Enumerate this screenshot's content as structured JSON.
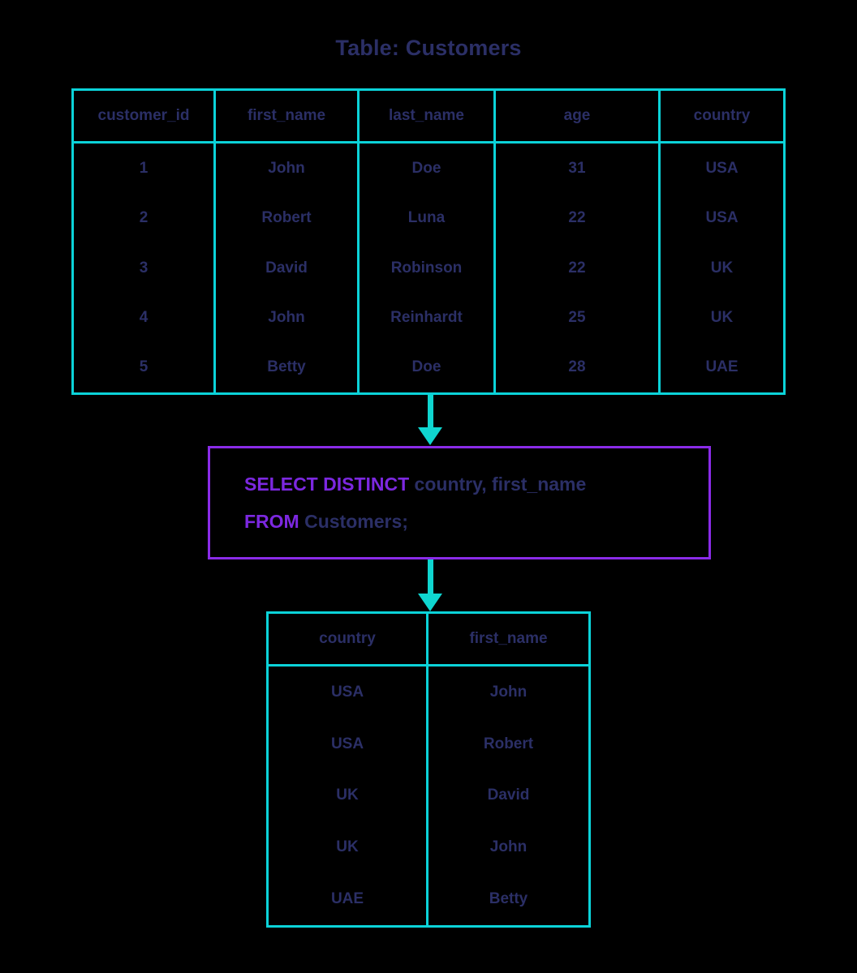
{
  "title": "Table: Customers",
  "colors": {
    "table_border": "#0bd3d9",
    "arrow": "#0fd6d0",
    "query_border": "#8a2be8",
    "keyword": "#7c28e0",
    "text": "#2b2f66",
    "background": "#000000"
  },
  "customers_table": {
    "name": "Customers",
    "columns": [
      "customer_id",
      "first_name",
      "last_name",
      "age",
      "country"
    ],
    "rows": [
      [
        "1",
        "John",
        "Doe",
        "31",
        "USA"
      ],
      [
        "2",
        "Robert",
        "Luna",
        "22",
        "USA"
      ],
      [
        "3",
        "David",
        "Robinson",
        "22",
        "UK"
      ],
      [
        "4",
        "John",
        "Reinhardt",
        "25",
        "UK"
      ],
      [
        "5",
        "Betty",
        "Doe",
        "28",
        "UAE"
      ]
    ]
  },
  "query": {
    "line1": {
      "keyword": "SELECT DISTINCT",
      "rest": " country, first_name"
    },
    "line2": {
      "keyword": "FROM",
      "rest": " Customers;"
    },
    "full_text": "SELECT DISTINCT country, first_name FROM Customers;"
  },
  "result_table": {
    "columns": [
      "country",
      "first_name"
    ],
    "rows": [
      [
        "USA",
        "John"
      ],
      [
        "USA",
        "Robert"
      ],
      [
        "UK",
        "David"
      ],
      [
        "UK",
        "John"
      ],
      [
        "UAE",
        "Betty"
      ]
    ]
  },
  "arrows": {
    "top": "down-arrow",
    "bottom": "down-arrow"
  }
}
